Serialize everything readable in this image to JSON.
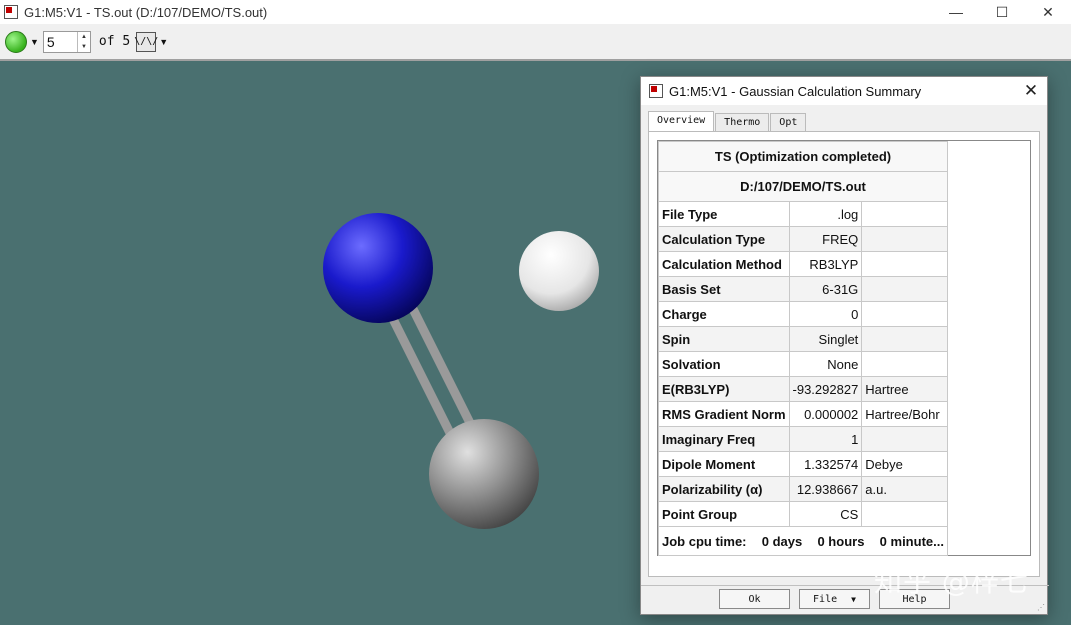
{
  "window": {
    "title": "G1:M5:V1 - TS.out (D:/107/DEMO/TS.out)",
    "minimize": "—",
    "maximize": "☐",
    "close": "✕"
  },
  "toolbar": {
    "frame_value": "5",
    "of_text": "of 5",
    "vib_icon_label": "\\/\\/"
  },
  "dialog": {
    "title": "G1:M5:V1 - Gaussian Calculation Summary",
    "close": "✕",
    "tabs": [
      "Overview",
      "Thermo",
      "Opt"
    ],
    "header1": "TS (Optimization completed)",
    "header2": "D:/107/DEMO/TS.out",
    "rows": [
      {
        "label": "File Type",
        "value": ".log",
        "unit": ""
      },
      {
        "label": "Calculation Type",
        "value": "FREQ",
        "unit": ""
      },
      {
        "label": "Calculation Method",
        "value": "RB3LYP",
        "unit": ""
      },
      {
        "label": "Basis Set",
        "value": "6-31G",
        "unit": ""
      },
      {
        "label": "Charge",
        "value": "0",
        "unit": ""
      },
      {
        "label": "Spin",
        "value": "Singlet",
        "unit": ""
      },
      {
        "label": "Solvation",
        "value": "None",
        "unit": ""
      },
      {
        "label": "E(RB3LYP)",
        "value": "-93.292827",
        "unit": "Hartree"
      },
      {
        "label": "RMS Gradient Norm",
        "value": "0.000002",
        "unit": "Hartree/Bohr"
      },
      {
        "label": "Imaginary Freq",
        "value": "1",
        "unit": ""
      },
      {
        "label": "Dipole Moment",
        "value": "1.332574",
        "unit": "Debye"
      },
      {
        "label": "Polarizability (α)",
        "value": "12.938667",
        "unit": "a.u."
      },
      {
        "label": "Point Group",
        "value": "CS",
        "unit": ""
      }
    ],
    "cpu": {
      "label": "Job cpu time:",
      "days": "0 days",
      "hours": "0 hours",
      "minutes": "0 minute..."
    },
    "buttons": {
      "ok": "Ok",
      "file": "File",
      "help": "Help"
    }
  },
  "watermark": "知乎 @梓七",
  "colors": {
    "background": "#4a7070",
    "nitrogen": "#1a1acc",
    "hydrogen": "#f0f0f0",
    "carbon": "#8a8a8a"
  }
}
